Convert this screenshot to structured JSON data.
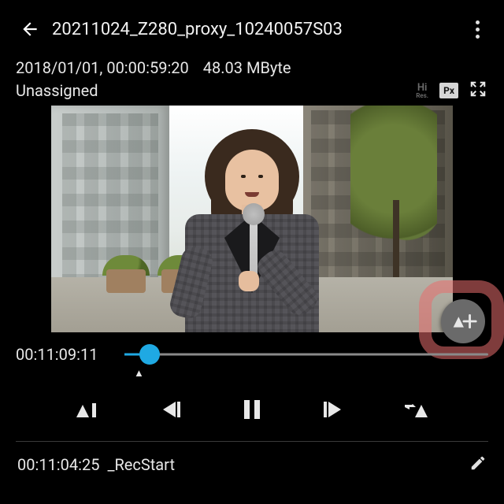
{
  "header": {
    "title": "20211024_Z280_proxy_10240057S03"
  },
  "meta": {
    "date_tc": "2018/01/01, 00:00:59:20",
    "filesize": "48.03 MByte",
    "assignment": "Unassigned"
  },
  "badges": {
    "hires_line1": "Hi",
    "hires_line2": "Res.",
    "px_label": "Px"
  },
  "fab": {
    "icon": "marker-add"
  },
  "timeline": {
    "current_tc": "00:11:09:11",
    "progress_pct": 7
  },
  "event": {
    "tc": "00:11:04:25",
    "label": "_RecStart"
  }
}
